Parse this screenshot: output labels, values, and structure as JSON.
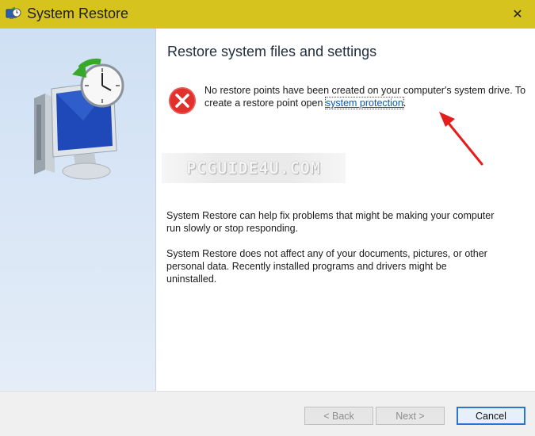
{
  "window": {
    "title": "System Restore",
    "icon": "system-restore-icon",
    "close_glyph": "✕"
  },
  "content": {
    "heading": "Restore system files and settings",
    "error_message_prefix": "No restore points have been created on your computer's system drive. To create a restore point open ",
    "link_text": "system protection",
    "error_message_suffix": ".",
    "paragraph1": "System Restore can help fix problems that might be making your computer run slowly or stop responding.",
    "paragraph2": "System Restore does not affect any of your documents, pictures, or other personal data. Recently installed programs and drivers might be uninstalled."
  },
  "watermark": "PCGUIDE4U.COM",
  "buttons": {
    "back": "< Back",
    "next": "Next >",
    "cancel": "Cancel"
  },
  "colors": {
    "titlebar": "#d6c31e",
    "link": "#0b55b8",
    "error": "#e0312d",
    "annotation_arrow": "#e41e1e"
  }
}
